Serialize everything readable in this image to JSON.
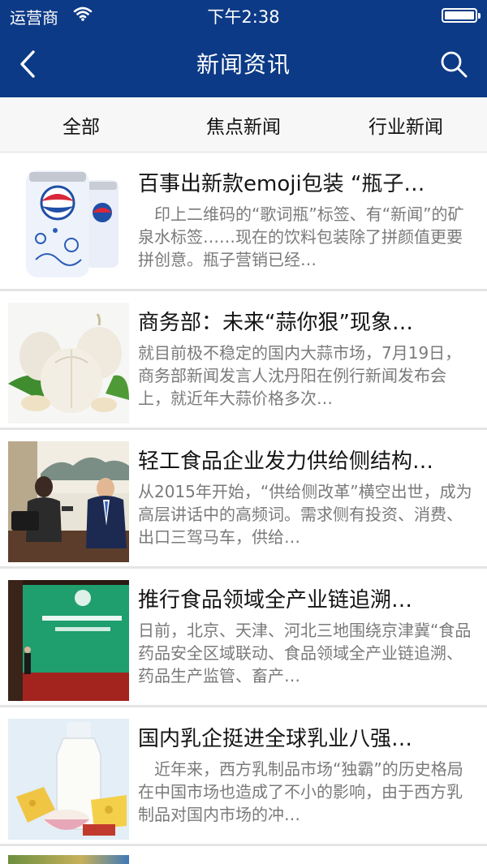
{
  "status_bar": {
    "carrier": "运营商",
    "time": "下午2:38"
  },
  "nav": {
    "title": "新闻资讯",
    "back_icon": "chevron-left-icon",
    "search_icon": "search-icon"
  },
  "tabs": [
    {
      "label": "全部"
    },
    {
      "label": "焦点新闻"
    },
    {
      "label": "行业新闻"
    }
  ],
  "news": [
    {
      "title": "百事出新款emoji包装 “瓶子…",
      "summary": "　印上二维码的“歌词瓶”标签、有“新闻”的矿泉水标签……现在的饮料包装除了拼颜值更要拼创意。瓶子营销已经…",
      "image": "pepsi-cans"
    },
    {
      "title": "商务部：未来“蒜你狠”现象…",
      "summary": "就目前极不稳定的国内大蒜市场，7月19日，商务部新闻发言人沈丹阳在例行新闻发布会上，就近年大蒜价格多次…",
      "image": "garlic"
    },
    {
      "title": "轻工食品企业发力供给侧结构…",
      "summary": "从2015年开始，“供给侧改革”横空出世，成为高层讲话中的高频词。需求侧有投资、消费、出口三驾马车，供给…",
      "image": "interview"
    },
    {
      "title": "推行食品领域全产业链追溯…",
      "summary": "日前，北京、天津、河北三地围绕京津冀“食品药品安全区域联动、食品领域全产业链追溯、药品生产监管、畜产…",
      "image": "forum-stage"
    },
    {
      "title": "国内乳企挺进全球乳业八强…",
      "summary": "　近年来，西方乳制品市场“独霸”的历史格局在中国市场也造成了不小的影响，由于西方乳制品对国内市场的冲…",
      "image": "dairy"
    }
  ]
}
